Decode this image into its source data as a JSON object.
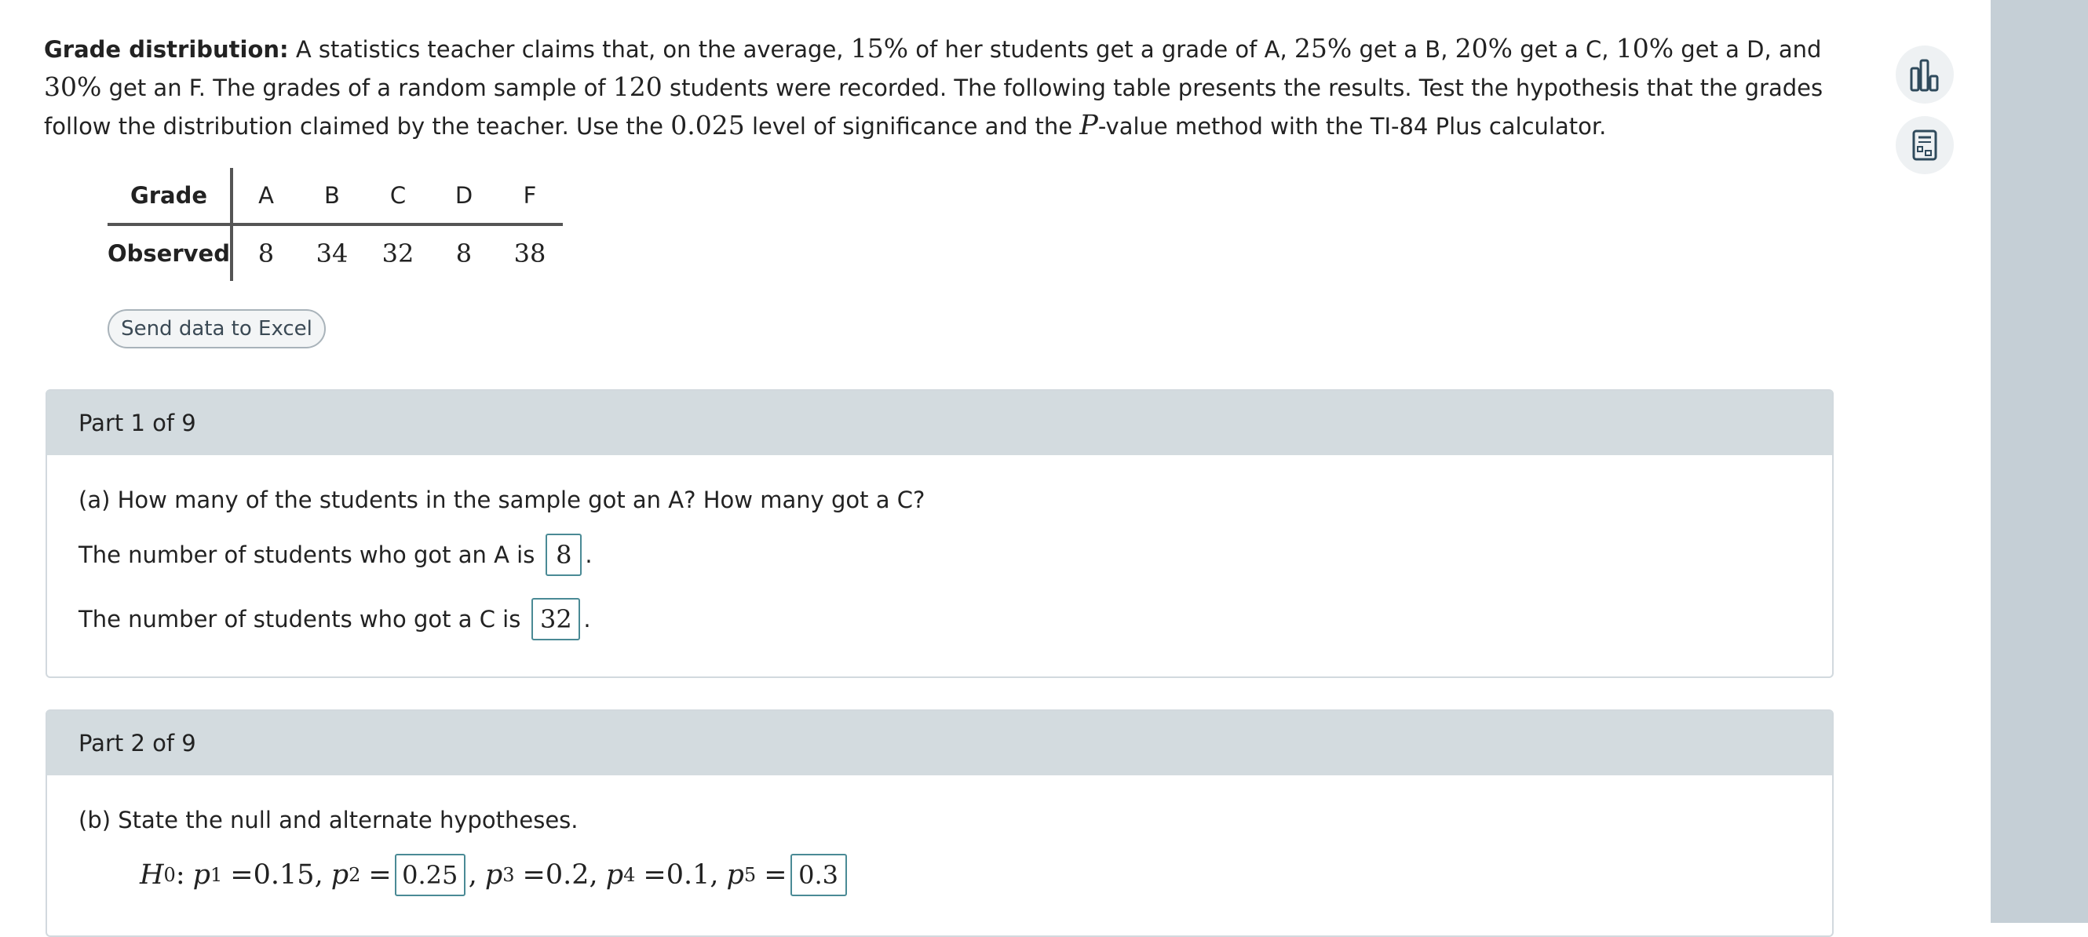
{
  "intro": {
    "label": "Grade distribution:",
    "t1": " A statistics teacher claims that, on the average, ",
    "pA": "15%",
    "t2": " of her students get a grade of A, ",
    "pB": "25%",
    "t3": " get a B, ",
    "pC": "20%",
    "t4": " get a C, ",
    "pD": "10%",
    "t5": " get a D, and ",
    "pF": "30%",
    "t6": " get an F. The grades of a random sample of ",
    "n": "120",
    "t7": " students were recorded. The following table presents the results. Test the hypothesis that the grades follow the distribution claimed by the teacher. Use the ",
    "alpha": "0.025",
    "t8": " level of significance and the ",
    "P": "P",
    "t9": "-value method with the TI-84 Plus calculator."
  },
  "table": {
    "row1_label": "Grade",
    "row2_label": "Observed",
    "grades": [
      "A",
      "B",
      "C",
      "D",
      "F"
    ],
    "observed": [
      "8",
      "34",
      "32",
      "8",
      "38"
    ]
  },
  "send_button": "Send data to Excel",
  "part1": {
    "header": "Part 1 of 9",
    "question": "(a) How many of the students in the sample got an A? How many got a C?",
    "line1": "The number of students who got an A is",
    "answer1": "8",
    "line2": "The number of students who got a C is",
    "answer2": "32",
    "period": "."
  },
  "part2": {
    "header": "Part 2 of 9",
    "question": "(b) State the null and alternate hypotheses.",
    "H": "H",
    "H_sub": "0",
    "p": "p",
    "s1": "1",
    "s2": "2",
    "s3": "3",
    "s4": "4",
    "s5": "5",
    "colon": ":",
    "eq": "=",
    "comma": ",",
    "v1": "0.15",
    "v2": "0.25",
    "v3": "0.2",
    "v4": "0.1",
    "v5": "0.3"
  },
  "tools": {
    "icon1": "bar-chart-icon",
    "icon2": "calculator-icon"
  },
  "colors": {
    "header_bg": "#d3dbdf",
    "right_panel": "#c5cfd6",
    "answer_border": "#4a8a95"
  }
}
